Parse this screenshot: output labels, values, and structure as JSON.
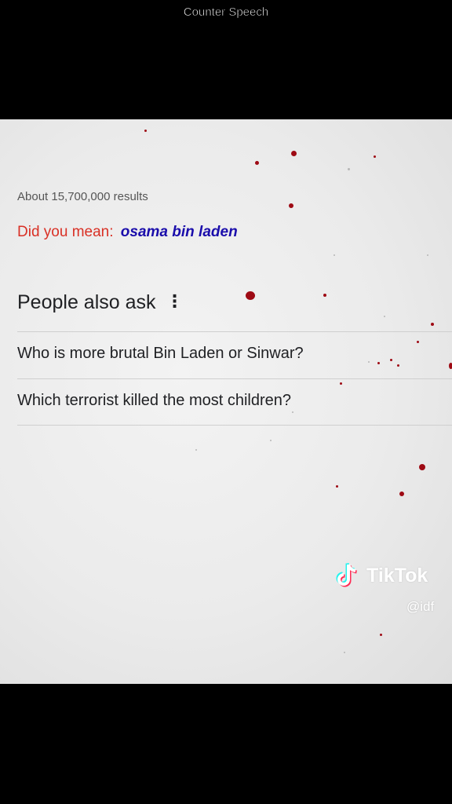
{
  "caption": "Counter Speech",
  "search": {
    "results_count": "About 15,700,000 results",
    "did_you_mean_label": "Did you mean:",
    "did_you_mean_suggestion": "osama bin laden"
  },
  "people_also_ask": {
    "heading": "People also ask",
    "menu_icon": "kebab-menu-icon",
    "questions": [
      "Who is more brutal Bin Laden or Sinwar?",
      "Which terrorist killed the most children?"
    ]
  },
  "watermark": {
    "brand": "TikTok",
    "handle": "@idf",
    "icon": "tiktok-note-icon"
  },
  "colors": {
    "did_you_mean": "#d93025",
    "suggestion_link": "#1a0dab",
    "blood_speck": "#9e0a14",
    "letterbox": "#000000"
  }
}
